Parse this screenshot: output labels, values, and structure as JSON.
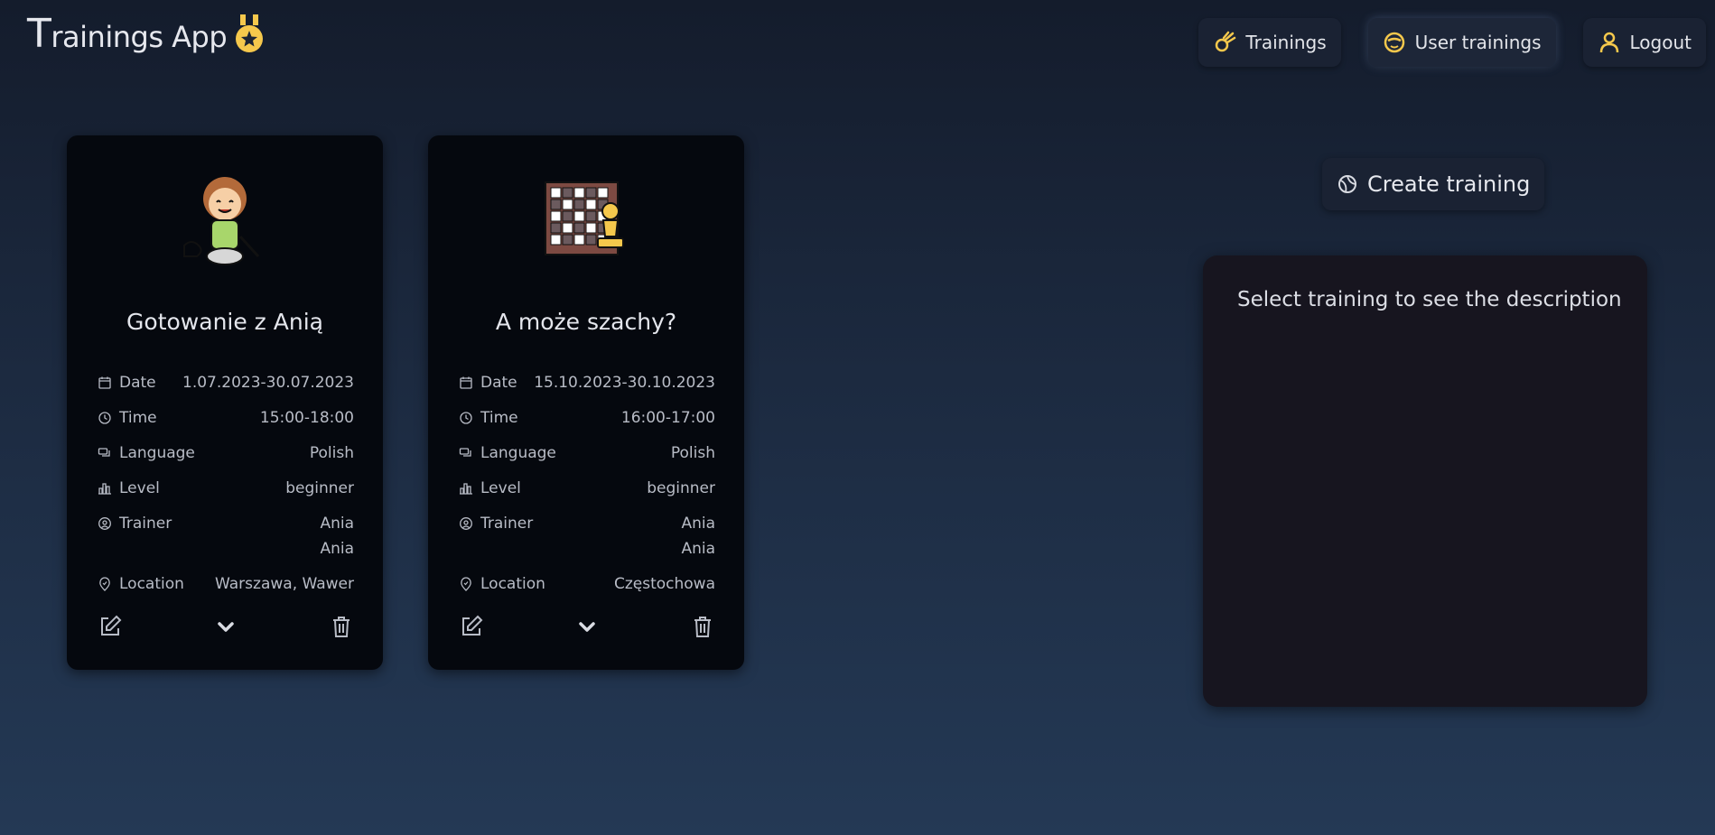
{
  "app": {
    "title_first": "T",
    "title_rest": "rainings App",
    "medal_icon": "medal-icon"
  },
  "nav": [
    {
      "label": "Trainings",
      "icon": "comet-icon"
    },
    {
      "label": "User trainings",
      "icon": "mask-face-icon"
    },
    {
      "label": "Logout",
      "icon": "user-icon"
    }
  ],
  "labels": {
    "date": "Date",
    "time": "Time",
    "language": "Language",
    "level": "Level",
    "trainer": "Trainer",
    "location": "Location"
  },
  "cards": [
    {
      "title": "Gotowanie z Anią",
      "illustration": "cooking-girl-icon",
      "date": "1.07.2023-30.07.2023",
      "time": "15:00-18:00",
      "language": "Polish",
      "level": "beginner",
      "trainer_first": "Ania",
      "trainer_last": "Ania",
      "location": "Warszawa, Wawer"
    },
    {
      "title": "A może szachy?",
      "illustration": "chess-board-icon",
      "date": "15.10.2023-30.10.2023",
      "time": "16:00-17:00",
      "language": "Polish",
      "level": "beginner",
      "trainer_first": "Ania",
      "trainer_last": "Ania",
      "location": "Częstochowa"
    }
  ],
  "create_button": {
    "label": "Create training"
  },
  "description_panel": {
    "title": "Select training to see the description"
  },
  "colors": {
    "accent": "#f5c84c",
    "card_bg": "#05080e",
    "panel_bg": "#17151f"
  }
}
